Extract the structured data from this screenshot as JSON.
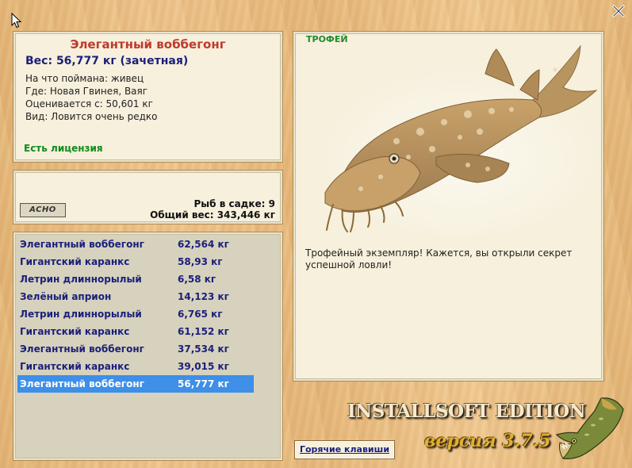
{
  "fish": {
    "name": "Элегантный воббегонг",
    "weight": "Вес: 56,777 кг (зачетная)",
    "bait": "На что поймана: живец",
    "location": "Где: Новая Гвинея, Ваяг",
    "rated_from": "Оценивается с: 50,601 кг",
    "rarity": "Вид: Ловится очень редко",
    "license": "Есть лицензия"
  },
  "keepnet": {
    "brand": "ACHO",
    "count": "Рыб в садке: 9",
    "total": "Общий вес: 343,446 кг"
  },
  "catch_list": [
    {
      "name": "Элегантный воббегонг",
      "weight": "62,564 кг"
    },
    {
      "name": "Гигантский каранкс",
      "weight": "58,93 кг"
    },
    {
      "name": "Летрин длиннорылый",
      "weight": "6,58 кг"
    },
    {
      "name": "Зелёный априон",
      "weight": "14,123 кг"
    },
    {
      "name": "Летрин длиннорылый",
      "weight": "6,765 кг"
    },
    {
      "name": "Гигантский каранкс",
      "weight": "61,152 кг"
    },
    {
      "name": "Элегантный воббегонг",
      "weight": "37,534 кг"
    },
    {
      "name": "Гигантский каранкс",
      "weight": "39,015 кг"
    },
    {
      "name": "Элегантный воббегонг",
      "weight": "56,777 кг",
      "selected": true
    }
  ],
  "trophy": {
    "label": "ТРОФЕЙ",
    "text": "Трофейный экземпляр! Кажется, вы открыли секрет успешной ловли!"
  },
  "buttons": {
    "hotkeys": "Горячие клавиши"
  },
  "branding": {
    "edition": "INSTALLSOFT EDITION",
    "version": "версия 3.7.5"
  },
  "icons": {
    "close": "close-icon",
    "cursor": "mouse-cursor-icon",
    "trophy_image": "wobbegong-shark-image",
    "logo": "pike-logo"
  },
  "colors": {
    "selected_row": "#3d8fe8",
    "list_text": "#1b1f7a",
    "fish_name": "#c0392b",
    "license": "#138a1d"
  }
}
